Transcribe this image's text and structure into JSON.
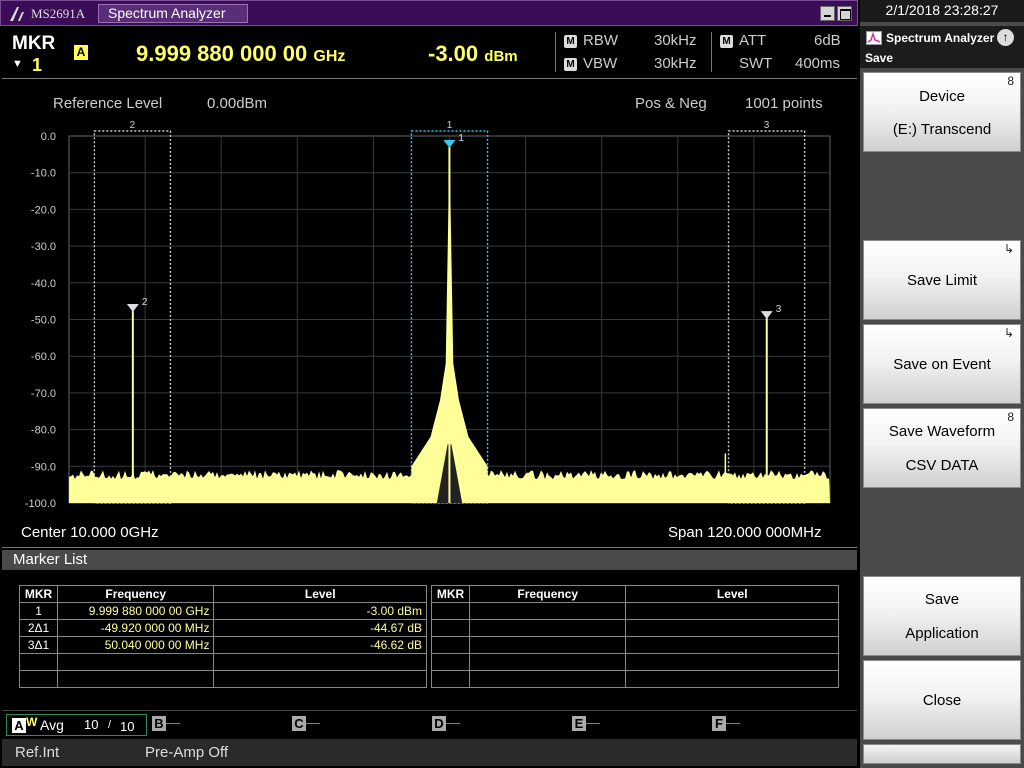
{
  "titlebar": {
    "model": "MS2691A",
    "app_title": "Spectrum Analyzer"
  },
  "marker_header": {
    "label": "MKR",
    "marker_number": "1",
    "trace_badge": "A",
    "frequency_value": "9.999 880 000 00",
    "frequency_unit": "GHz",
    "level_value": "-3.00",
    "level_unit": "dBm",
    "rbw_badge": "M",
    "rbw_label": "RBW",
    "rbw_value": "30kHz",
    "vbw_badge": "M",
    "vbw_label": "VBW",
    "vbw_value": "30kHz",
    "att_badge": "M",
    "att_label": "ATT",
    "att_value": "6dB",
    "swt_label": "SWT",
    "swt_value": "400ms"
  },
  "graph": {
    "reference_label": "Reference Level",
    "reference_value": "0.00dBm",
    "detection": "Pos & Neg",
    "points": "1001 points",
    "center": "Center 10.000 0GHz",
    "span": "Span 120.000 000MHz",
    "y_tick_labels": [
      "0.0",
      "-10.0",
      "-20.0",
      "-30.0",
      "-40.0",
      "-50.0",
      "-60.0",
      "-70.0",
      "-80.0",
      "-90.0",
      "-100.0"
    ],
    "marker_labels": [
      "1",
      "2",
      "3"
    ]
  },
  "chart_data": {
    "type": "line",
    "ylim": [
      -100,
      0
    ],
    "xlim_mhz": [
      -60,
      60
    ],
    "center_ghz": 10.0,
    "span_mhz": 120.0,
    "reference_level_dbm": 0.0,
    "noise_floor_dbm": -90,
    "series": [
      {
        "offset_mhz": [
          -60,
          -50,
          -12,
          -6,
          -3,
          -1,
          0,
          1,
          3,
          6,
          12,
          50,
          60
        ],
        "level_dbm": [
          -91,
          -46.6,
          -91,
          -86,
          -80,
          -62,
          -3,
          -62,
          -80,
          -86,
          -91,
          -48.6,
          -91
        ]
      }
    ],
    "markers": [
      {
        "number": "1",
        "offset_mhz": -0.012,
        "level_dbm": -3.0
      },
      {
        "number": "2",
        "offset_mhz": -49.932,
        "level_dbm": -47.67
      },
      {
        "number": "3",
        "offset_mhz": 50.028,
        "level_dbm": -49.62
      }
    ],
    "marker_zones_mhz": [
      {
        "number": "1",
        "from": -6,
        "to": 6,
        "color": "#33ccee"
      },
      {
        "number": "2",
        "from": -56,
        "to": -44,
        "color": "#cccccc"
      },
      {
        "number": "3",
        "from": 44,
        "to": 56,
        "color": "#cccccc"
      }
    ]
  },
  "marker_list": {
    "title": "Marker List",
    "columns": [
      "MKR",
      "Frequency",
      "Level"
    ],
    "rows": [
      [
        "1",
        "9.999 880 000 00 GHz",
        "-3.00 dBm"
      ],
      [
        "2Δ1",
        "-49.920 000 00 MHz",
        "-44.67 dB"
      ],
      [
        "3Δ1",
        "50.040 000 00 MHz",
        "-46.62 dB"
      ],
      [
        "",
        "",
        ""
      ],
      [
        "",
        "",
        ""
      ]
    ],
    "right_rows": [
      [
        "",
        "",
        ""
      ],
      [
        "",
        "",
        ""
      ],
      [
        "",
        "",
        ""
      ],
      [
        "",
        "",
        ""
      ],
      [
        "",
        "",
        ""
      ]
    ]
  },
  "trace_bar": {
    "active_letter": "A",
    "active_mode": "W",
    "mode": "Avg",
    "count": "10",
    "separator": "/",
    "total": "10",
    "inactive": [
      "B",
      "C",
      "D",
      "E",
      "F"
    ],
    "dash": "—"
  },
  "status_bar": {
    "reference": "Ref.Int",
    "preamp": "Pre-Amp Off"
  },
  "side_panel": {
    "datetime": "2/1/2018 23:28:27",
    "app": "Spectrum Analyzer",
    "menu": "Save",
    "softkeys": [
      {
        "line1": "Device",
        "line2": "(E:) Transcend",
        "corner": "8"
      },
      {
        "line1": "",
        "line2": "",
        "corner": ""
      },
      {
        "line1": "Save Limit",
        "line2": "",
        "corner": "↳"
      },
      {
        "line1": "Save on Event",
        "line2": "",
        "corner": "↳"
      },
      {
        "line1": "Save Waveform",
        "line2": "CSV DATA",
        "corner": "8"
      },
      {
        "line1": "",
        "line2": "",
        "corner": ""
      },
      {
        "line1": "Save",
        "line2": "Application",
        "corner": ""
      },
      {
        "line1": "Close",
        "line2": "",
        "corner": ""
      }
    ]
  },
  "colors": {
    "trace": "#ffff99",
    "marker_text": "#ffff66",
    "active_zone": "#33ccee",
    "title_bg": "#3b0d56"
  }
}
